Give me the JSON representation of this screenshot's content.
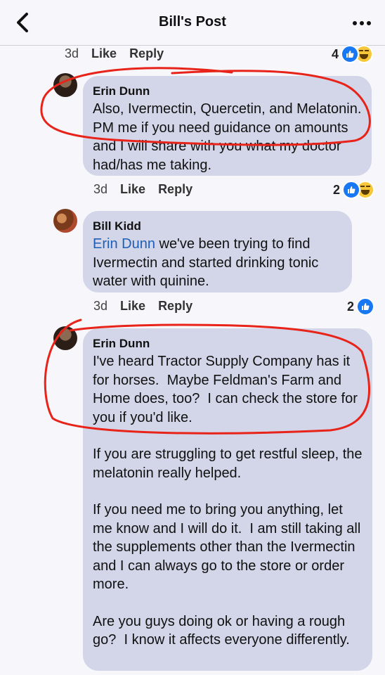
{
  "header": {
    "title": "Bill's Post"
  },
  "comments": [
    {
      "time": "3d",
      "like_label": "Like",
      "reply_label": "Reply",
      "reaction_count": "4",
      "reactions": [
        "like-icon",
        "haha-icon"
      ]
    },
    {
      "author": "Erin Dunn",
      "text": "Also, Ivermectin, Quercetin, and Melatonin.  PM me if you need guidance on amounts and I will share with you what my doctor had/has me taking.",
      "time": "3d",
      "like_label": "Like",
      "reply_label": "Reply",
      "reaction_count": "2",
      "reactions": [
        "like-icon",
        "haha-icon"
      ]
    },
    {
      "author": "Bill Kidd",
      "mention": "Erin Dunn",
      "text": " we've been trying to find Ivermectin and started drinking tonic water with quinine.",
      "time": "3d",
      "like_label": "Like",
      "reply_label": "Reply",
      "reaction_count": "2",
      "reactions": [
        "like-icon"
      ]
    },
    {
      "author": "Erin Dunn",
      "paragraphs": [
        "I've heard Tractor Supply Company has it for horses.  Maybe Feldman's Farm and Home does, too?  I can check the store for you if you'd like.",
        "If you are struggling to get restful sleep, the melatonin really helped.",
        "If you need me to bring you anything, let me know and I will do it.  I am still taking all the supplements other than the Ivermectin and I can always go to the store or order more.",
        "Are you guys doing ok or having a rough go?  I know it affects everyone differently."
      ]
    }
  ],
  "colors": {
    "bubble": "#d2d6e8",
    "like_blue": "#1877f2",
    "annotation_red": "#e8231a",
    "mention_blue": "#1d5fb8"
  }
}
